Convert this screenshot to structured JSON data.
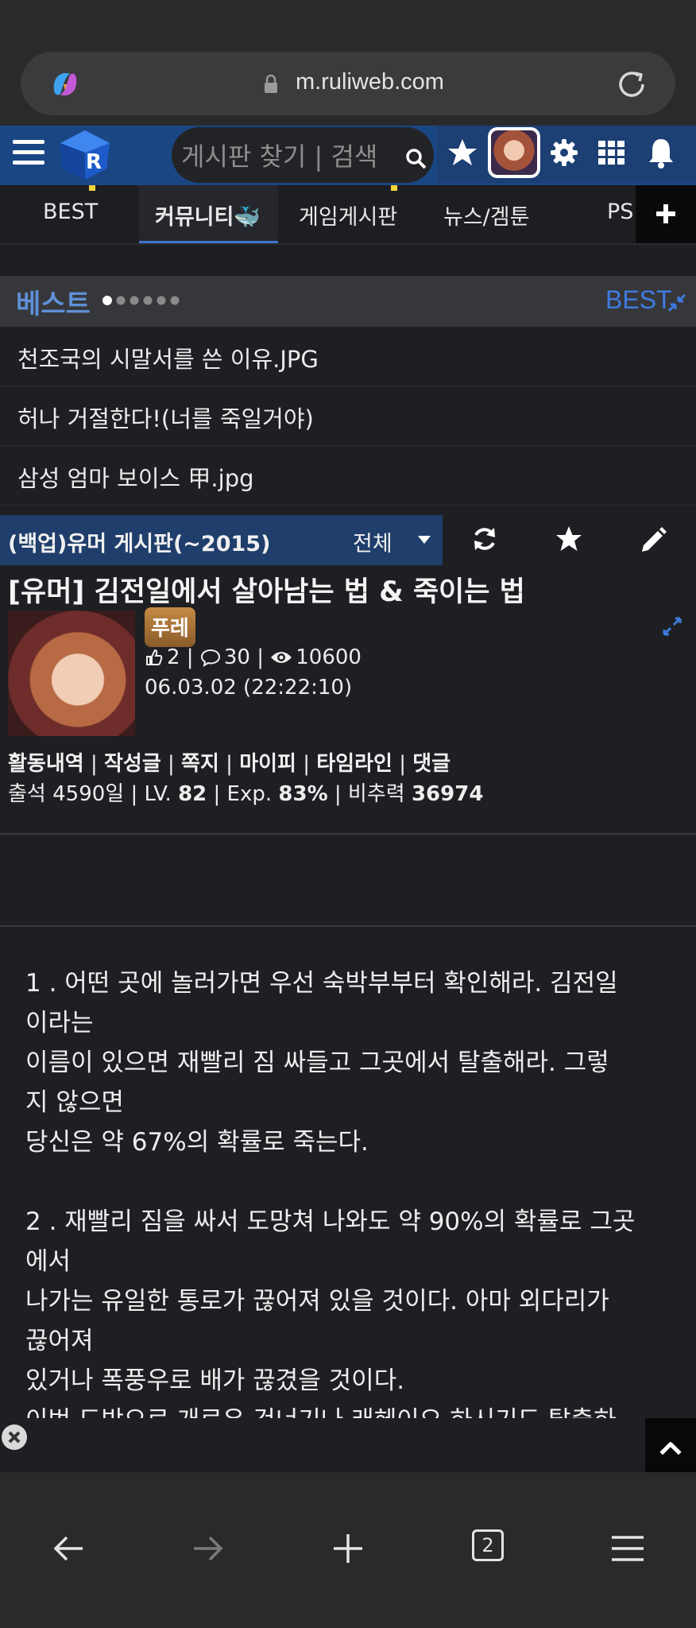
{
  "browser": {
    "url": "m.ruliweb.com",
    "tab_count": "2"
  },
  "header": {
    "search_placeholder": "게시판 찾기 | 검색"
  },
  "nav": {
    "tabs": [
      "BEST",
      "커뮤니티🐳",
      "게임게시판",
      "뉴스/겜툰",
      "PS"
    ],
    "active": "커뮤니티🐳"
  },
  "best": {
    "title": "베스트",
    "link_label": "BEST",
    "items": [
      "천조국의 시말서를 쓴 이유.JPG",
      "허나 거절한다!(너를 죽일거야)",
      "삼성 엄마 보이스 甲.jpg"
    ]
  },
  "board": {
    "title": "(백업)유머 게시판(~2015)",
    "filter": "전체"
  },
  "post": {
    "title": "[유머] 김전일에서 살아남는 법 & 죽이는 법",
    "author": "푸레",
    "likes": "2",
    "comments": "30",
    "views": "10600",
    "date": "06.03.02 (22:22:10)",
    "user_links": [
      "활동내역",
      "작성글",
      "쪽지",
      "마이피",
      "타임라인",
      "댓글"
    ],
    "attendance": "출석 4590일 |",
    "level_label": "LV.",
    "level": "82",
    "exp_label": "| Exp.",
    "exp": "83%",
    "power_label": "| 비추력",
    "power": "36974",
    "body_lines": [
      "1 . 어떤 곳에 놀러가면 우선 숙박부부터 확인해라. 김전일",
      "이라는",
      "이름이 있으면 재빨리 짐 싸들고 그곳에서 탈출해라. 그렇",
      "지 않으면",
      "당신은 약 67%의 확률로 죽는다.",
      "",
      "2 . 재빨리 짐을 싸서 도망쳐 나와도 약 90%의 확률로 그곳",
      "에서",
      "나가는 유일한 통로가 끊어져 있을 것이다. 아마 외다리가",
      "끊어져",
      "있거나 폭풍우로 배가 끊겼을 것이다.",
      "이번 도박으로 개로우 건너기나 래헤이오 하시기도 탈출하"
    ]
  },
  "colors": {
    "header_blue": "#1a4784",
    "accent_blue": "#3f7be0",
    "dark_bg": "#1e1f23"
  }
}
